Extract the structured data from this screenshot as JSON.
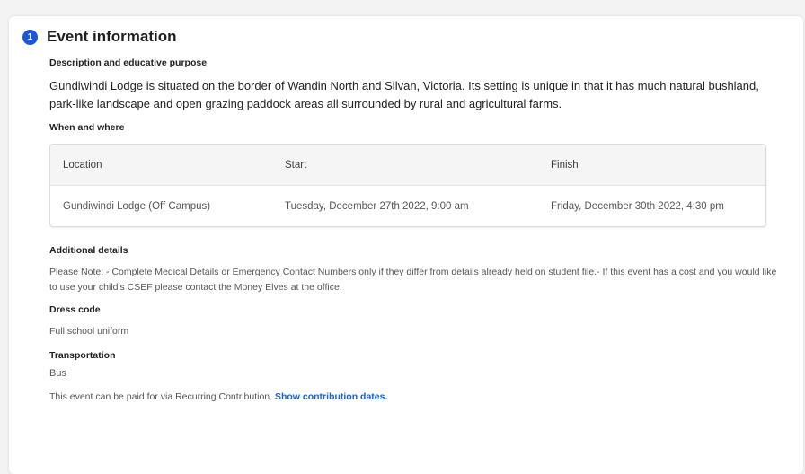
{
  "section": {
    "step_number": "1",
    "title": "Event information"
  },
  "description": {
    "label": "Description and educative purpose",
    "text": "Gundiwindi Lodge is situated on the border of Wandin North and Silvan, Victoria. Its setting is unique in that it has much natural bushland, park-like landscape and open grazing paddock areas all surrounded by rural and agricultural farms."
  },
  "when_where": {
    "label": "When and where",
    "columns": [
      "Location",
      "Start",
      "Finish"
    ],
    "rows": [
      [
        "Gundiwindi Lodge  (Off Campus)",
        "Tuesday, December 27th 2022, 9:00 am",
        "Friday, December 30th 2022, 4:30 pm"
      ]
    ]
  },
  "additional": {
    "label": "Additional details",
    "text": "Please Note: - Complete Medical Details or Emergency Contact Numbers only if they differ from details already held on student file.- If this event has a cost and you would like to use your child's CSEF please contact the Money Elves at the office."
  },
  "dress_code": {
    "label": "Dress code",
    "value": "Full school uniform"
  },
  "transportation": {
    "label": "Transportation",
    "value": "Bus"
  },
  "contribution": {
    "text": "This event can be paid for via Recurring Contribution. ",
    "link": "Show contribution dates."
  },
  "colors": {
    "accent": "#1b57d6",
    "link": "#1b62c9"
  }
}
